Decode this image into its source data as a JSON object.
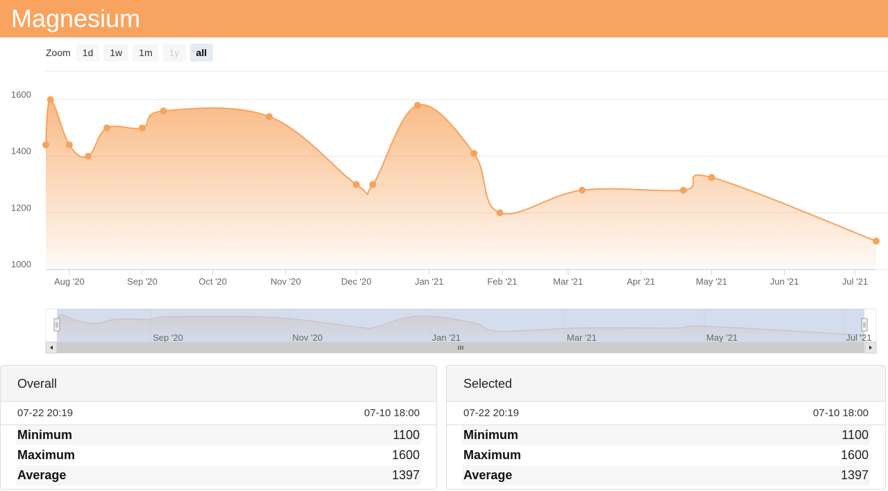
{
  "app": {
    "title": "Magnesium"
  },
  "zoom": {
    "label": "Zoom",
    "buttons": [
      {
        "label": "1d",
        "state": "normal"
      },
      {
        "label": "1w",
        "state": "normal"
      },
      {
        "label": "1m",
        "state": "normal"
      },
      {
        "label": "1y",
        "state": "disabled"
      },
      {
        "label": "all",
        "state": "active"
      }
    ]
  },
  "colors": {
    "accent": "#f9a360",
    "line": "#f7a35c",
    "navigator_fill": "#c9d6ea",
    "grid": "#e6e6e6"
  },
  "chart_data": {
    "type": "area",
    "title": "Magnesium",
    "xlabel": "",
    "ylabel": "",
    "ylim": [
      1000,
      1700
    ],
    "yticks": [
      "1000",
      "1200",
      "1400",
      "1600"
    ],
    "x_range": [
      "2020-07-22",
      "2021-07-10"
    ],
    "xticks": [
      {
        "date": "2020-08-01",
        "label": "Aug '20"
      },
      {
        "date": "2020-09-01",
        "label": "Sep '20"
      },
      {
        "date": "2020-10-01",
        "label": "Oct '20"
      },
      {
        "date": "2020-11-01",
        "label": "Nov '20"
      },
      {
        "date": "2020-12-01",
        "label": "Dec '20"
      },
      {
        "date": "2021-01-01",
        "label": "Jan '21"
      },
      {
        "date": "2021-02-01",
        "label": "Feb '21"
      },
      {
        "date": "2021-03-01",
        "label": "Mar '21"
      },
      {
        "date": "2021-04-01",
        "label": "Apr '21"
      },
      {
        "date": "2021-05-01",
        "label": "May '21"
      },
      {
        "date": "2021-06-01",
        "label": "Jun '21"
      },
      {
        "date": "2021-07-01",
        "label": "Jul '21"
      }
    ],
    "navigator_ticks": [
      {
        "date": "2020-09-01",
        "label": "Sep '20"
      },
      {
        "date": "2020-11-01",
        "label": "Nov '20"
      },
      {
        "date": "2021-01-01",
        "label": "Jan '21"
      },
      {
        "date": "2021-03-01",
        "label": "Mar '21"
      },
      {
        "date": "2021-05-01",
        "label": "May '21"
      },
      {
        "date": "2021-07-01",
        "label": "Jul '21"
      }
    ],
    "series": [
      {
        "x": [
          "2020-07-22",
          "2020-07-24",
          "2020-08-01",
          "2020-08-09",
          "2020-08-17",
          "2020-09-01",
          "2020-09-10",
          "2020-10-25",
          "2020-12-01",
          "2020-12-08",
          "2020-12-27",
          "2021-01-20",
          "2021-01-31",
          "2021-03-07",
          "2021-04-19",
          "2021-05-01",
          "2021-07-10"
        ],
        "values": [
          1440,
          1600,
          1440,
          1400,
          1500,
          1500,
          1560,
          1540,
          1300,
          1300,
          1580,
          1410,
          1200,
          1280,
          1280,
          1325,
          1100
        ]
      }
    ]
  },
  "stats": {
    "overall": {
      "title": "Overall",
      "start": "07-22 20:19",
      "end": "07-10 18:00",
      "min_label": "Minimum",
      "min": "1100",
      "max_label": "Maximum",
      "max": "1600",
      "avg_label": "Average",
      "avg": "1397"
    },
    "selected": {
      "title": "Selected",
      "start": "07-22 20:19",
      "end": "07-10 18:00",
      "min_label": "Minimum",
      "min": "1100",
      "max_label": "Maximum",
      "max": "1600",
      "avg_label": "Average",
      "avg": "1397"
    }
  }
}
